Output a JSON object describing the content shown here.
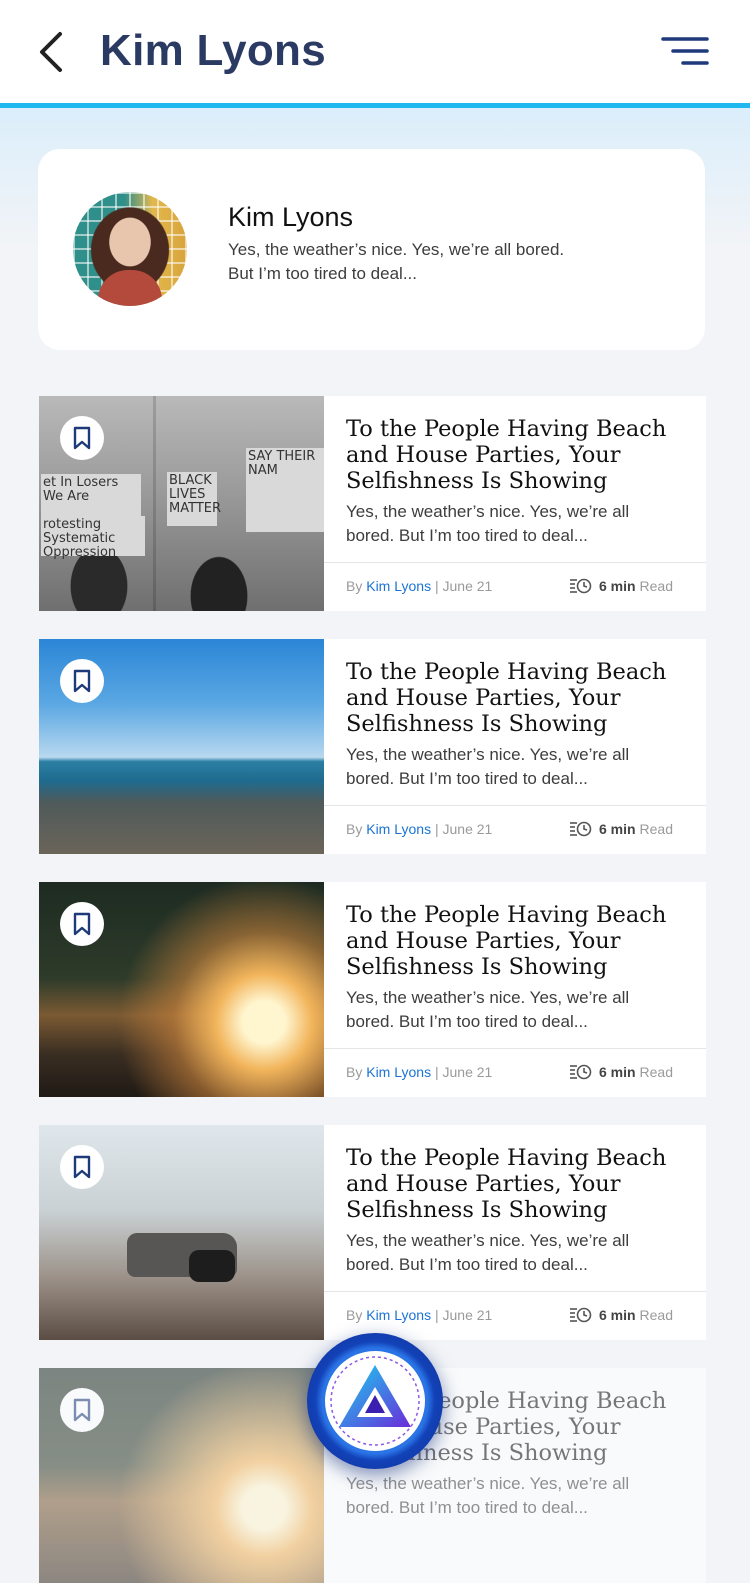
{
  "header": {
    "title": "Kim Lyons",
    "back_icon": "chevron-left-icon",
    "menu_icon": "menu-lines-icon"
  },
  "profile": {
    "name": "Kim Lyons",
    "bio_line1": "Yes, the weather’s nice. Yes, we’re all bored.",
    "bio_line2": "But I’m too tired to deal..."
  },
  "colors": {
    "accent": "#1fb8ef",
    "title": "#2b3a63",
    "author_link": "#1b74d4",
    "fab": "#1a4fd1"
  },
  "articles": [
    {
      "title": "To the People Having Beach and House Parties, Your Selfishness Is Showing",
      "excerpt": "Yes, the weather’s nice. Yes, we’re all bored. But I’m too tired to deal...",
      "by": "By",
      "author": "Kim Lyons",
      "date": "| June 21",
      "read_time": "6 min",
      "read_label": "Read",
      "image": "protest-photo",
      "sign1": "et In Losers We Are",
      "sign2": "BLACK LIVES MATTER",
      "sign3": "SAY THEIR NAM",
      "sign4": "rotesting Systematic Oppression"
    },
    {
      "title": "To the People Having Beach and House Parties, Your Selfishness Is Showing",
      "excerpt": "Yes, the weather’s nice. Yes, we’re all bored. But I’m too tired to deal...",
      "by": "By",
      "author": "Kim Lyons",
      "date": "| June 21",
      "read_time": "6 min",
      "read_label": "Read",
      "image": "sea-pier-photo"
    },
    {
      "title": "To the People Having Beach and House Parties, Your Selfishness Is Showing",
      "excerpt": "Yes, the weather’s nice. Yes, we’re all bored. But I’m too tired to deal...",
      "by": "By",
      "author": "Kim Lyons",
      "date": "| June 21",
      "read_time": "6 min",
      "read_label": "Read",
      "image": "lake-sunrise-photo"
    },
    {
      "title": "To the People Having Beach and House Parties, Your Selfishness Is Showing",
      "excerpt": "Yes, the weather’s nice. Yes, we’re all bored. But I’m too tired to deal...",
      "by": "By",
      "author": "Kim Lyons",
      "date": "| June 21",
      "read_time": "6 min",
      "read_label": "Read",
      "image": "drone-photo"
    },
    {
      "title": "To the People Having Beach and House Parties, Your Selfishness Is Showing",
      "excerpt": "Yes, the weather’s nice. Yes, we’re all bored. But I’m too tired to deal...",
      "image": "lake-sunrise-photo"
    }
  ],
  "fab": {
    "icon": "triangle-logo-icon"
  }
}
